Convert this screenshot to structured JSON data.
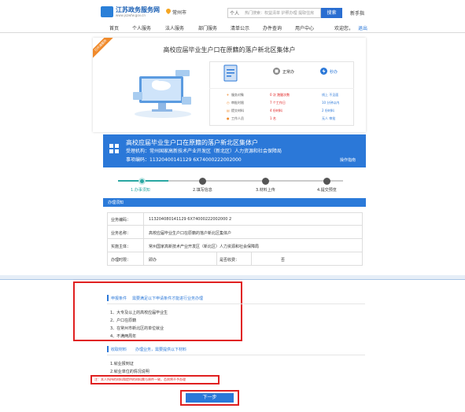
{
  "header": {
    "logo_title": "江苏政务服务网",
    "logo_sub": "www.jszwfw.gov.cn",
    "location": "常州市",
    "search_category": "个人",
    "search_placeholder": "热门搜索：权益清单 护照办理 提取住房",
    "search_button": "搜索",
    "guide_link": "新手指",
    "nav": [
      "首页",
      "个人服务",
      "法人服务",
      "部门服务",
      "清单公示",
      "办件查询",
      "用户中心",
      "欢迎您，",
      "退出"
    ]
  },
  "service_card": {
    "ribbon": "已开通服务",
    "title": "高校应届毕业生户口在原籍的落户新北区集体户",
    "left_labels": [
      "服务对象",
      "审批时限",
      "提交材料",
      "工作人员"
    ],
    "left_values": [
      "一次",
      "个工作日",
      "份材料",
      "名"
    ],
    "left_numbers": [
      "次",
      "7",
      "4",
      "1"
    ],
    "right_titles": [
      "正常办",
      "秒办"
    ],
    "right_values": [
      "线上 不见面",
      "10 分钟以内",
      "2 份材料",
      "无人 审批"
    ],
    "normal_col": [
      "0 次  跑腿次数",
      "7 个工作日",
      "4 份材料",
      "1 名"
    ]
  },
  "banner": {
    "title": "高校应届毕业生户口在原籍的落户新北区集体户",
    "org": "受理机构：常州国家高新技术产业开发区（新北区）人力资源和社会保障局",
    "code": "事项编码：11320400141129 6X74000222002000",
    "link": "操作指南"
  },
  "steps": {
    "labels": [
      "1.办事须知",
      "2.填写信息",
      "3.材料上传",
      "4.提交预览"
    ],
    "current": 1
  },
  "info_table": {
    "header": "办理须知",
    "rows": [
      {
        "label": "业务编码：",
        "value": "113204080141129 6X74000222002000 2"
      },
      {
        "label": "业务名称：",
        "value": "高校应届毕业生户口在原籍的落户新北区集体户"
      },
      {
        "label": "实施主体：",
        "value": "常州国家高新技术产业开发区（新北区）人力资源和社会保障局"
      },
      {
        "label": "办理时限：",
        "value": "即办",
        "label2": "是否收费：",
        "value2": "否"
      }
    ]
  },
  "conditions": {
    "title": "申报条件",
    "subtitle": "需要满足以下申请条件才能进行业务办理",
    "items": [
      "1、大专及以上的高校应届毕业生",
      "2、户口在原籍",
      "3、在常州市新北区的单位就业",
      "4、不满两周年"
    ]
  },
  "materials": {
    "title": "收取材料",
    "subtitle": "办理业务，需要提供以下材料",
    "items": [
      "1.就业报到证",
      "2.就业单位的情况说明"
    ],
    "hint": "注：本人所持的材料和提供的材料需与原件一致，否则将不予办理"
  },
  "next_button": "下一步",
  "colors": {
    "primary": "#2b78d8",
    "accent": "#f08a2b",
    "alert": "#e02020",
    "step_done": "#2aa7a2"
  }
}
